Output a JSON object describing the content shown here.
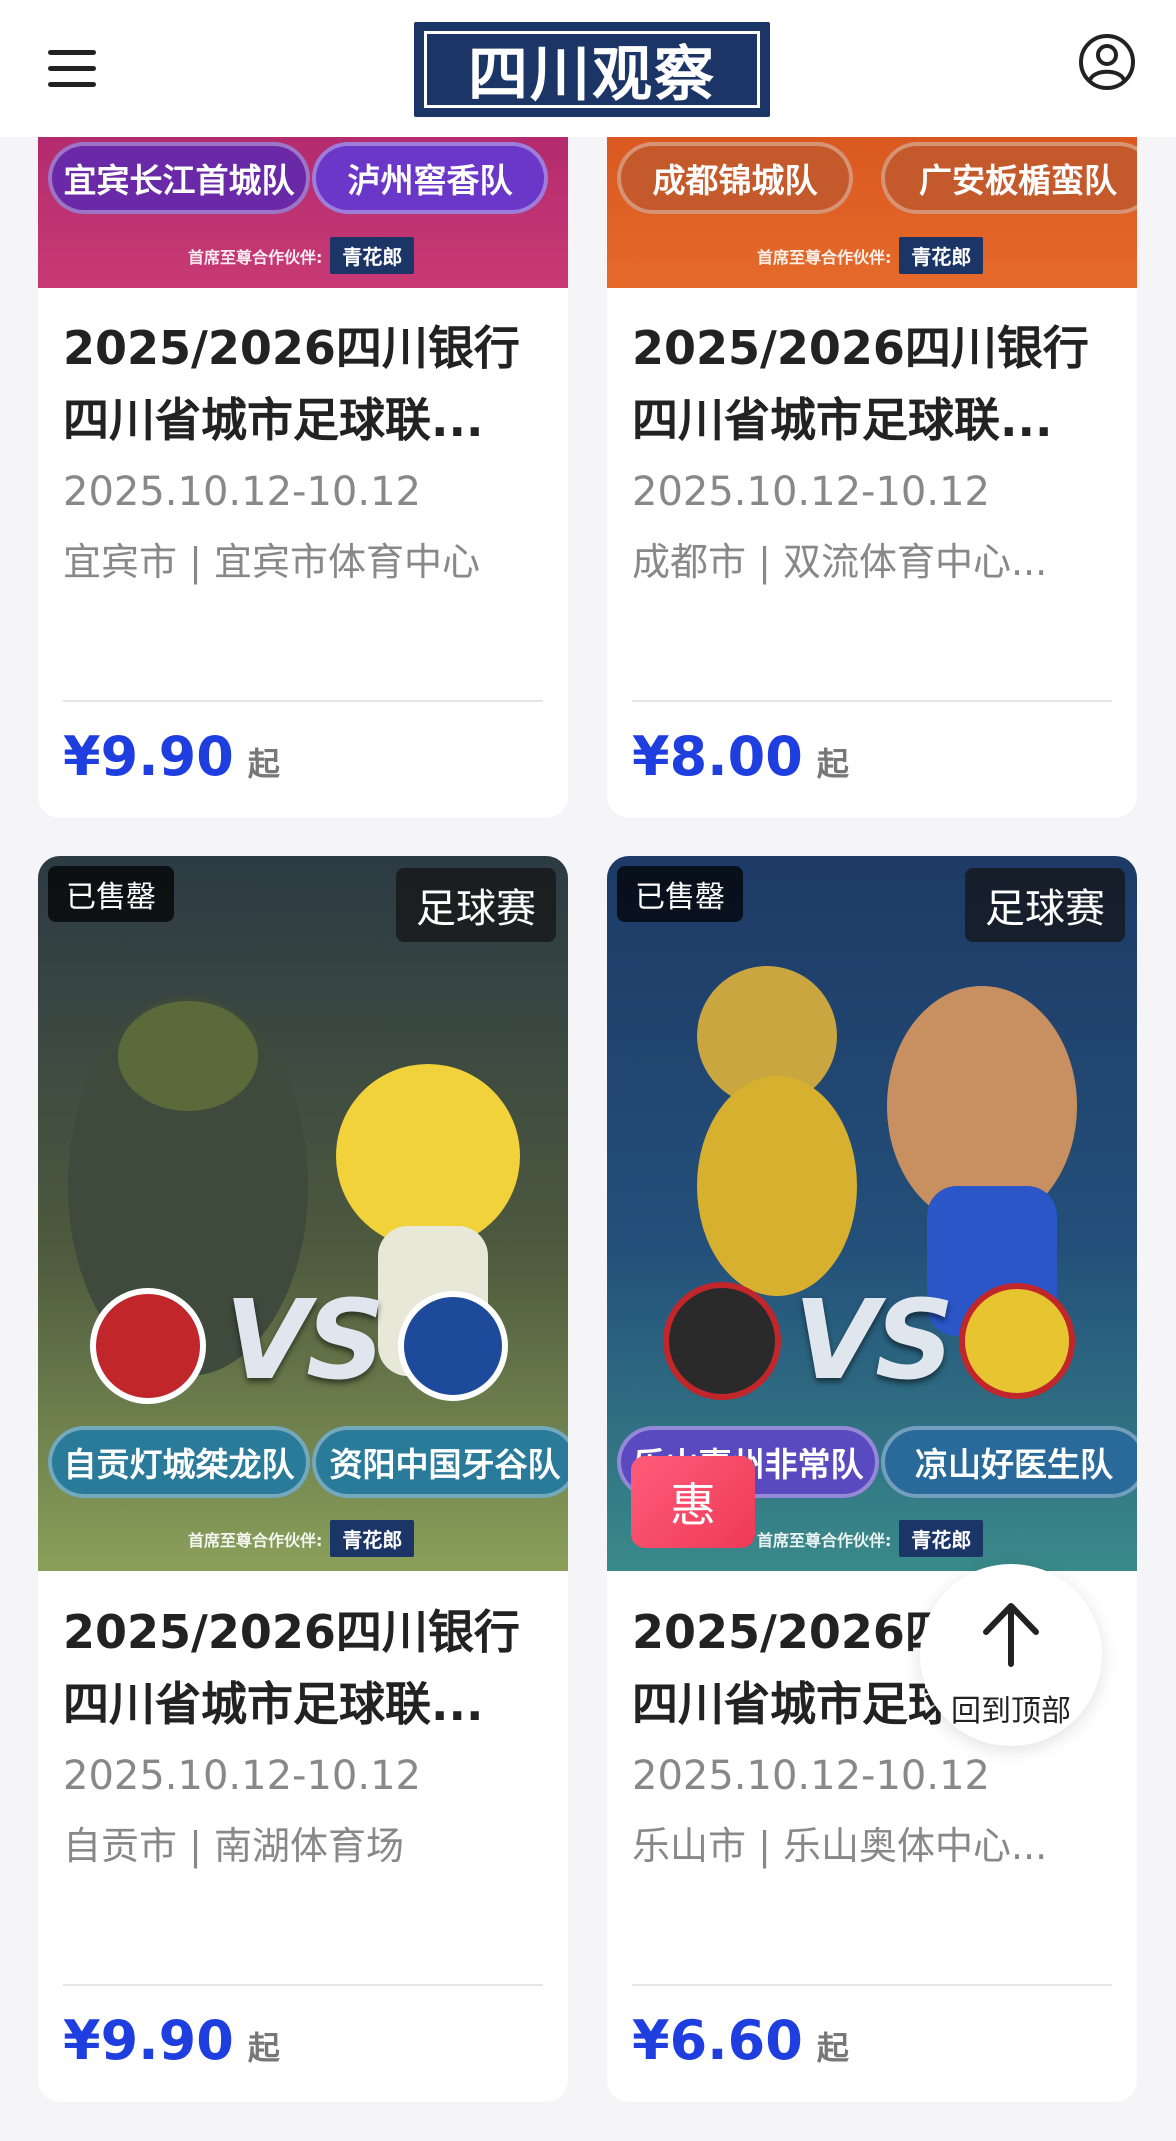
{
  "header": {
    "logo_text": "四川观察",
    "menu_icon": "menu-icon",
    "user_icon": "user-icon"
  },
  "colors": {
    "price": "#1f3ee0",
    "logo_bg": "#1b3566",
    "promo_badge": "#ee3a57"
  },
  "cards": [
    {
      "teams": [
        "宜宾长江首城队",
        "泸州窖香队"
      ],
      "sponsor_label": "首席至尊合作伙伴:",
      "sponsor": "青花郎",
      "title_line1": "2025/2026四川银行",
      "title_line2": "四川省城市足球联...",
      "date": "2025.10.12-10.12",
      "venue": "宜宾市 | 宜宾市体育中心",
      "price": "¥9.90",
      "price_suffix": "起"
    },
    {
      "teams": [
        "成都锦城队",
        "广安板楯蛮队"
      ],
      "sponsor_label": "首席至尊合作伙伴:",
      "sponsor": "青花郎",
      "title_line1": "2025/2026四川银行",
      "title_line2": "四川省城市足球联...",
      "date": "2025.10.12-10.12",
      "venue": "成都市 | 双流体育中心...",
      "price": "¥8.00",
      "price_suffix": "起"
    },
    {
      "status": "已售罄",
      "category": "足球赛",
      "vs": "VS",
      "teams": [
        "自贡灯城桀龙队",
        "资阳中国牙谷队"
      ],
      "sponsor_label": "首席至尊合作伙伴:",
      "sponsor": "青花郎",
      "title_line1": "2025/2026四川银行",
      "title_line2": "四川省城市足球联...",
      "date": "2025.10.12-10.12",
      "venue": "自贡市 | 南湖体育场",
      "price": "¥9.90",
      "price_suffix": "起"
    },
    {
      "status": "已售罄",
      "category": "足球赛",
      "vs": "VS",
      "teams": [
        "乐山嘉州非常队",
        "凉山好医生队"
      ],
      "promo": "惠",
      "sponsor_label": "首席至尊合作伙伴:",
      "sponsor": "青花郎",
      "title_line1": "2025/2026四川银行",
      "title_line2": "四川省城市足球联...",
      "date": "2025.10.12-10.12",
      "venue": "乐山市 | 乐山奥体中心...",
      "price": "¥6.60",
      "price_suffix": "起"
    }
  ],
  "back_to_top": {
    "label": "回到顶部",
    "icon": "arrow-up-icon"
  }
}
